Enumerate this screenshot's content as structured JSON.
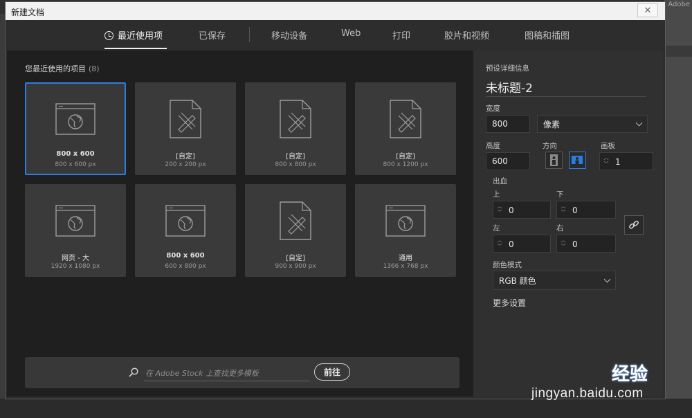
{
  "background": {
    "corner_text": "Adobe"
  },
  "dialog": {
    "title": "新建文档",
    "close_glyph": "✕"
  },
  "tabs": [
    {
      "label": "最近使用项",
      "active": true
    },
    {
      "label": "已保存"
    },
    {
      "label": "移动设备"
    },
    {
      "label": "Web"
    },
    {
      "label": "打印"
    },
    {
      "label": "胶片和视频"
    },
    {
      "label": "图稿和插图"
    }
  ],
  "recent": {
    "heading": "您最近使用的项目",
    "count": "(8)",
    "items": [
      {
        "name": "800 x 600",
        "size": "800 x 600 px",
        "icon": "web-icon"
      },
      {
        "name": "[自定]",
        "size": "200 x 200 px",
        "icon": "doc-pencil-icon"
      },
      {
        "name": "[自定]",
        "size": "800 x 800 px",
        "icon": "doc-pencil-icon"
      },
      {
        "name": "[自定]",
        "size": "800 x 1200 px",
        "icon": "doc-pencil-icon"
      },
      {
        "name": "网页 - 大",
        "size": "1920 x 1080 px",
        "icon": "web-icon"
      },
      {
        "name": "800 x 600",
        "size": "600 x 800 px",
        "icon": "web-icon"
      },
      {
        "name": "[自定]",
        "size": "900 x 900 px",
        "icon": "doc-pencil-icon"
      },
      {
        "name": "通用",
        "size": "1366 x 768 px",
        "icon": "web-icon"
      }
    ]
  },
  "stock": {
    "placeholder": "在 Adobe Stock 上查找更多模板",
    "go_label": "前往"
  },
  "preset": {
    "heading": "预设详细信息",
    "doc_title": "未标题-2",
    "width_label": "宽度",
    "width_value": "800",
    "unit": "像素",
    "height_label": "高度",
    "height_value": "600",
    "orientation_label": "方向",
    "artboard_label": "画板",
    "artboard_value": "1",
    "bleed_label": "出血",
    "top_label": "上",
    "top_value": "0",
    "bottom_label": "下",
    "bottom_value": "0",
    "left_label": "左",
    "left_value": "0",
    "right_label": "右",
    "right_value": "0",
    "color_mode_label": "颜色模式",
    "color_mode_value": "RGB 颜色",
    "more_settings": "更多设置"
  },
  "watermark": {
    "logo": "经验",
    "url": "jingyan.baidu.com"
  }
}
